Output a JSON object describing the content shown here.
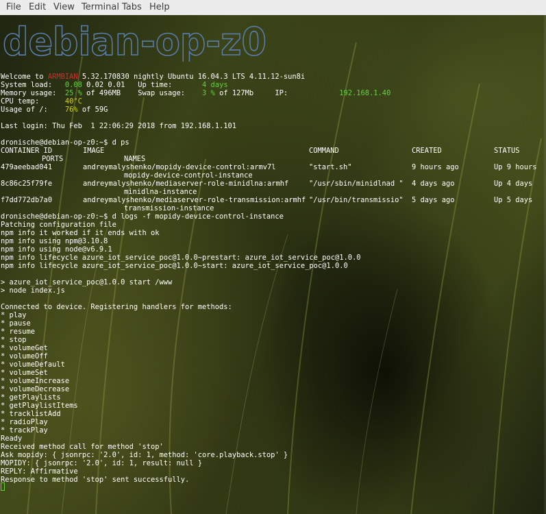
{
  "menu": [
    "File",
    "Edit",
    "View",
    "Terminal",
    "Tabs",
    "Help"
  ],
  "banner": {
    "text": "debian-op-z0",
    "color": "#5a7fb0"
  },
  "colors": {
    "red": "#cf2e2e",
    "yellow": "#d7d200",
    "green": "#62d241",
    "text": "#ffffff"
  },
  "motd": {
    "welcome_prefix": "Welcome to ",
    "os_name": "ARMBIAN",
    "welcome_suffix": " 5.32.170830 nightly Ubuntu 16.04.3 LTS 4.11.12-sun8i",
    "load_label": "System load:   ",
    "load_1": "0.08",
    "load_rest": " 0.02 0.01   Up time:       ",
    "uptime": "4 days",
    "mem_label": "Memory usage:  ",
    "mem_pct": "25 %",
    "mem_rest": " of 496MB    Swap usage:    ",
    "swap_pct": "3 %",
    "swap_rest": " of 127Mb     IP:            ",
    "ip": "192.168.1.40",
    "cpu_label": "CPU temp:      ",
    "cpu_temp": "40°C",
    "usage_label": "Usage of /:    ",
    "usage_pct": "76%",
    "usage_rest": " of 59G"
  },
  "last_login": "Last login: Thu Feb  1 22:06:29 2018 from 192.168.1.101",
  "cmd_ps": "dronische@debian-op-z0:~$ d ps",
  "ps_headers": {
    "container_id": "CONTAINER ID",
    "image": "IMAGE",
    "command": "COMMAND",
    "created": "CREATED",
    "status": "STATUS",
    "ports": "PORTS",
    "names": "NAMES"
  },
  "ps_rows": [
    {
      "id": "479aeebad041",
      "image": "andreymalyshenko/mopidy-device-control:armv7l",
      "command": "\"start.sh\"",
      "created": "9 hours ago",
      "status": "Up 9 hours",
      "name": "mopidy-device-control-instance"
    },
    {
      "id": "8c86c25f79fe",
      "image": "andreymalyshenko/mediaserver-role-minidlna:armhf",
      "command": "\"/usr/sbin/minidlnad \"",
      "created": "4 days ago",
      "status": "Up 4 days",
      "name": "minidlna-instance"
    },
    {
      "id": "f7dd772db7a0",
      "image": "andreymalyshenko/mediaserver-role-transmission:armhf",
      "command": "\"/usr/bin/transmissio\"",
      "created": "5 days ago",
      "status": "Up 5 days",
      "name": "transmission-instance"
    }
  ],
  "log_lines": [
    "dronische@debian-op-z0:~$ d logs -f mopidy-device-control-instance",
    "Patching configuration file",
    "npm info it worked if it ends with ok",
    "npm info using npm@3.10.8",
    "npm info using node@v6.9.1",
    "npm info lifecycle azure_iot_service_poc@1.0.0~prestart: azure_iot_service_poc@1.0.0",
    "npm info lifecycle azure_iot_service_poc@1.0.0~start: azure_iot_service_poc@1.0.0",
    "",
    "> azure_iot_service_poc@1.0.0 start /www",
    "> node index.js",
    "",
    "Connected to device. Registering handlers for methods:",
    "* play",
    "* pause",
    "* resume",
    "* stop",
    "* volumeGet",
    "* volumeOff",
    "* volumeDefault",
    "* volumeSet",
    "* volumeIncrease",
    "* volumeDecrease",
    "* getPlaylists",
    "* getPlaylistItems",
    "* tracklistAdd",
    "* radioPlay",
    "* trackPlay",
    "Ready",
    "Received method call for method 'stop'",
    "Ask mopidy: { jsonrpc: '2.0', id: 1, method: 'core.playback.stop' }",
    "MOPIDY: { jsonrpc: '2.0', id: 1, result: null }",
    "REPLY: Affirmative",
    "Response to method 'stop' sent successfully."
  ]
}
